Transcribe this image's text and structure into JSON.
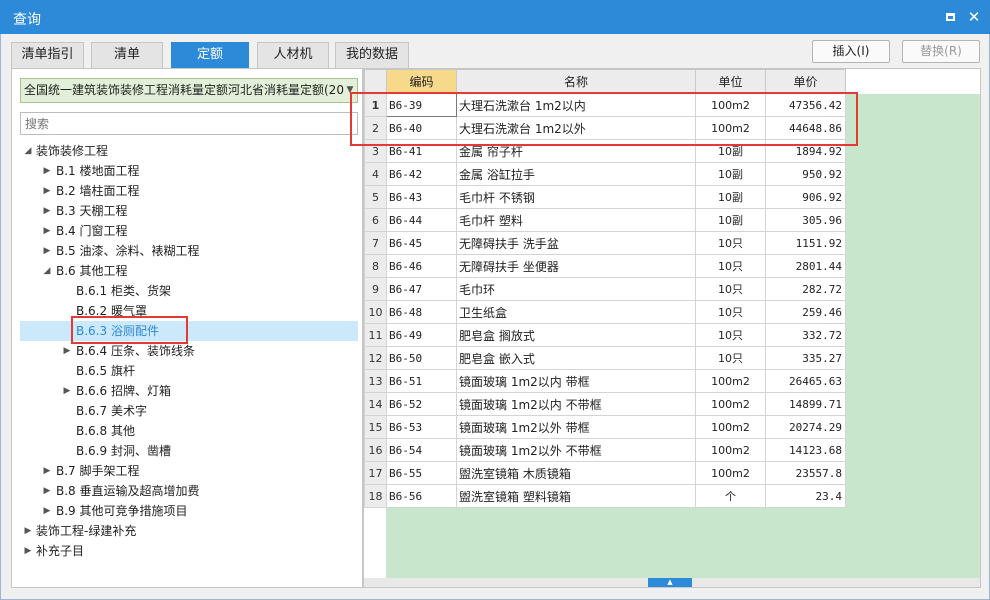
{
  "window": {
    "title": "查询"
  },
  "tabs": [
    {
      "label": "清单指引"
    },
    {
      "label": "清单"
    },
    {
      "label": "定额",
      "active": true
    },
    {
      "label": "人材机"
    },
    {
      "label": "我的数据"
    }
  ],
  "actions": {
    "insert_label": "插入(I)",
    "replace_label": "替换(R)"
  },
  "quota_library": {
    "selected": "全国统一建筑装饰装修工程消耗量定额河北省消耗量定额(20"
  },
  "search": {
    "placeholder": "搜索"
  },
  "tree": [
    {
      "label": "装饰装修工程",
      "state": "expanded"
    },
    {
      "label": "B.1 楼地面工程",
      "state": "collapsed"
    },
    {
      "label": "B.2 墙柱面工程",
      "state": "collapsed"
    },
    {
      "label": "B.3 天棚工程",
      "state": "collapsed"
    },
    {
      "label": "B.4 门窗工程",
      "state": "collapsed"
    },
    {
      "label": "B.5 油漆、涂料、裱糊工程",
      "state": "collapsed"
    },
    {
      "label": "B.6 其他工程",
      "state": "expanded"
    },
    {
      "label": "B.6.1 柜类、货架",
      "state": "leaf"
    },
    {
      "label": "B.6.2 暖气罩",
      "state": "leaf"
    },
    {
      "label": "B.6.3 浴厕配件",
      "state": "leaf",
      "selected": true
    },
    {
      "label": "B.6.4 压条、装饰线条",
      "state": "collapsed"
    },
    {
      "label": "B.6.5 旗杆",
      "state": "leaf"
    },
    {
      "label": "B.6.6 招牌、灯箱",
      "state": "collapsed"
    },
    {
      "label": "B.6.7 美术字",
      "state": "leaf"
    },
    {
      "label": "B.6.8 其他",
      "state": "leaf"
    },
    {
      "label": "B.6.9 封洞、凿槽",
      "state": "leaf"
    },
    {
      "label": "B.7 脚手架工程",
      "state": "collapsed"
    },
    {
      "label": "B.8 垂直运输及超高增加费",
      "state": "collapsed"
    },
    {
      "label": "B.9 其他可竞争措施项目",
      "state": "collapsed"
    },
    {
      "label": "装饰工程-绿建补充",
      "state": "collapsed"
    },
    {
      "label": "补充子目",
      "state": "collapsed"
    }
  ],
  "table": {
    "columns": [
      "编码",
      "名称",
      "单位",
      "单价"
    ],
    "rows": [
      {
        "no": "1",
        "code": "B6-39",
        "name": "大理石洗漱台 1m2以内",
        "unit": "100m2",
        "price": "47356.42"
      },
      {
        "no": "2",
        "code": "B6-40",
        "name": "大理石洗漱台 1m2以外",
        "unit": "100m2",
        "price": "44648.86"
      },
      {
        "no": "3",
        "code": "B6-41",
        "name": "金属 帘子杆",
        "unit": "10副",
        "price": "1894.92"
      },
      {
        "no": "4",
        "code": "B6-42",
        "name": "金属 浴缸拉手",
        "unit": "10副",
        "price": "950.92"
      },
      {
        "no": "5",
        "code": "B6-43",
        "name": "毛巾杆 不锈钢",
        "unit": "10副",
        "price": "906.92"
      },
      {
        "no": "6",
        "code": "B6-44",
        "name": "毛巾杆 塑料",
        "unit": "10副",
        "price": "305.96"
      },
      {
        "no": "7",
        "code": "B6-45",
        "name": "无障碍扶手 洗手盆",
        "unit": "10只",
        "price": "1151.92"
      },
      {
        "no": "8",
        "code": "B6-46",
        "name": "无障碍扶手 坐便器",
        "unit": "10只",
        "price": "2801.44"
      },
      {
        "no": "9",
        "code": "B6-47",
        "name": "毛巾环",
        "unit": "10只",
        "price": "282.72"
      },
      {
        "no": "10",
        "code": "B6-48",
        "name": "卫生纸盒",
        "unit": "10只",
        "price": "259.46"
      },
      {
        "no": "11",
        "code": "B6-49",
        "name": "肥皂盒 搁放式",
        "unit": "10只",
        "price": "332.72"
      },
      {
        "no": "12",
        "code": "B6-50",
        "name": "肥皂盒 嵌入式",
        "unit": "10只",
        "price": "335.27"
      },
      {
        "no": "13",
        "code": "B6-51",
        "name": "镜面玻璃 1m2以内 带框",
        "unit": "100m2",
        "price": "26465.63"
      },
      {
        "no": "14",
        "code": "B6-52",
        "name": "镜面玻璃 1m2以内 不带框",
        "unit": "100m2",
        "price": "14899.71"
      },
      {
        "no": "15",
        "code": "B6-53",
        "name": "镜面玻璃 1m2以外 带框",
        "unit": "100m2",
        "price": "20274.29"
      },
      {
        "no": "16",
        "code": "B6-54",
        "name": "镜面玻璃 1m2以外 不带框",
        "unit": "100m2",
        "price": "14123.68"
      },
      {
        "no": "17",
        "code": "B6-55",
        "name": "盥洗室镜箱 木质镜箱",
        "unit": "100m2",
        "price": "23557.8"
      },
      {
        "no": "18",
        "code": "B6-56",
        "name": "盥洗室镜箱 塑料镜箱",
        "unit": "个",
        "price": "23.4"
      }
    ]
  },
  "colors": {
    "titlebar": "#2d8ad8",
    "active_tab": "#2d8ad8",
    "selected_tree": "#cce8fb",
    "highlight": "#e53935",
    "grid_empty": "#c8e6cc",
    "active_header": "#f7d98c"
  }
}
